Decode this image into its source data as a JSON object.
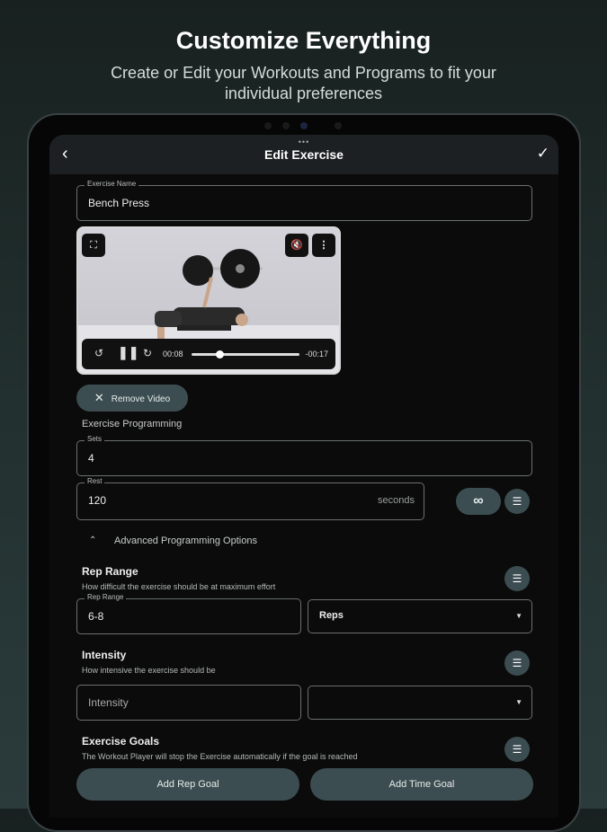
{
  "hero": {
    "title": "Customize Everything",
    "subtitle": "Create or Edit your Workouts and Programs to fit your individual preferences"
  },
  "header": {
    "title": "Edit Exercise",
    "back_icon": "chevron-left-icon",
    "confirm_icon": "check-icon"
  },
  "exercise_name": {
    "label": "Exercise Name",
    "value": "Bench Press"
  },
  "video": {
    "current_time": "00:08",
    "remaining_time": "-00:17",
    "progress": 0.26
  },
  "remove_video": "Remove Video",
  "programming": {
    "title": "Exercise Programming",
    "sets_label": "Sets",
    "sets_value": "4",
    "rest_label": "Rest",
    "rest_value": "120",
    "rest_unit": "seconds",
    "infinity": "∞"
  },
  "advanced": {
    "label": "Advanced Programming Options"
  },
  "rep_range": {
    "title": "Rep Range",
    "desc": "How difficult the exercise should be at maximum effort",
    "label": "Rep Range",
    "value": "6-8",
    "unit": "Reps"
  },
  "intensity": {
    "title": "Intensity",
    "desc": "How intensive the exercise should be",
    "placeholder": "Intensity",
    "unit": ""
  },
  "goals": {
    "title": "Exercise Goals",
    "desc": "The Workout Player will stop the Exercise automatically if the goal is reached",
    "add_rep": "Add Rep Goal",
    "add_time": "Add Time Goal"
  }
}
